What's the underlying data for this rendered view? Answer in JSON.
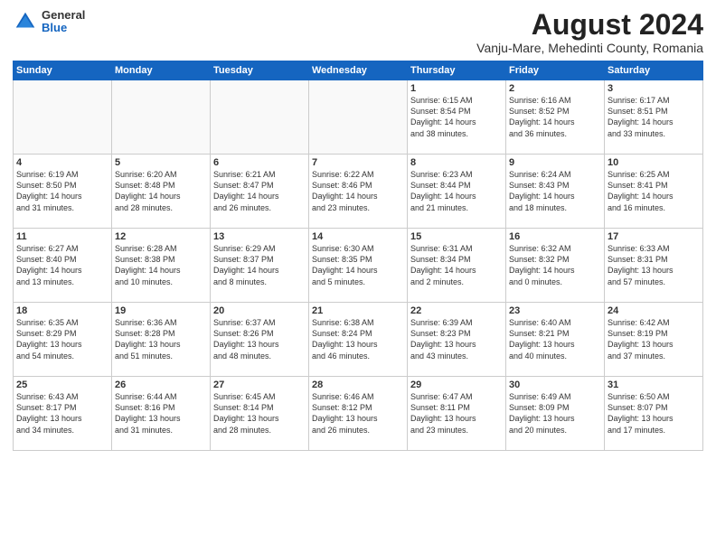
{
  "header": {
    "title": "August 2024",
    "subtitle": "Vanju-Mare, Mehedinti County, Romania",
    "logo_general": "General",
    "logo_blue": "Blue"
  },
  "weekdays": [
    "Sunday",
    "Monday",
    "Tuesday",
    "Wednesday",
    "Thursday",
    "Friday",
    "Saturday"
  ],
  "weeks": [
    [
      {
        "day": "",
        "text": ""
      },
      {
        "day": "",
        "text": ""
      },
      {
        "day": "",
        "text": ""
      },
      {
        "day": "",
        "text": ""
      },
      {
        "day": "1",
        "text": "Sunrise: 6:15 AM\nSunset: 8:54 PM\nDaylight: 14 hours\nand 38 minutes."
      },
      {
        "day": "2",
        "text": "Sunrise: 6:16 AM\nSunset: 8:52 PM\nDaylight: 14 hours\nand 36 minutes."
      },
      {
        "day": "3",
        "text": "Sunrise: 6:17 AM\nSunset: 8:51 PM\nDaylight: 14 hours\nand 33 minutes."
      }
    ],
    [
      {
        "day": "4",
        "text": "Sunrise: 6:19 AM\nSunset: 8:50 PM\nDaylight: 14 hours\nand 31 minutes."
      },
      {
        "day": "5",
        "text": "Sunrise: 6:20 AM\nSunset: 8:48 PM\nDaylight: 14 hours\nand 28 minutes."
      },
      {
        "day": "6",
        "text": "Sunrise: 6:21 AM\nSunset: 8:47 PM\nDaylight: 14 hours\nand 26 minutes."
      },
      {
        "day": "7",
        "text": "Sunrise: 6:22 AM\nSunset: 8:46 PM\nDaylight: 14 hours\nand 23 minutes."
      },
      {
        "day": "8",
        "text": "Sunrise: 6:23 AM\nSunset: 8:44 PM\nDaylight: 14 hours\nand 21 minutes."
      },
      {
        "day": "9",
        "text": "Sunrise: 6:24 AM\nSunset: 8:43 PM\nDaylight: 14 hours\nand 18 minutes."
      },
      {
        "day": "10",
        "text": "Sunrise: 6:25 AM\nSunset: 8:41 PM\nDaylight: 14 hours\nand 16 minutes."
      }
    ],
    [
      {
        "day": "11",
        "text": "Sunrise: 6:27 AM\nSunset: 8:40 PM\nDaylight: 14 hours\nand 13 minutes."
      },
      {
        "day": "12",
        "text": "Sunrise: 6:28 AM\nSunset: 8:38 PM\nDaylight: 14 hours\nand 10 minutes."
      },
      {
        "day": "13",
        "text": "Sunrise: 6:29 AM\nSunset: 8:37 PM\nDaylight: 14 hours\nand 8 minutes."
      },
      {
        "day": "14",
        "text": "Sunrise: 6:30 AM\nSunset: 8:35 PM\nDaylight: 14 hours\nand 5 minutes."
      },
      {
        "day": "15",
        "text": "Sunrise: 6:31 AM\nSunset: 8:34 PM\nDaylight: 14 hours\nand 2 minutes."
      },
      {
        "day": "16",
        "text": "Sunrise: 6:32 AM\nSunset: 8:32 PM\nDaylight: 14 hours\nand 0 minutes."
      },
      {
        "day": "17",
        "text": "Sunrise: 6:33 AM\nSunset: 8:31 PM\nDaylight: 13 hours\nand 57 minutes."
      }
    ],
    [
      {
        "day": "18",
        "text": "Sunrise: 6:35 AM\nSunset: 8:29 PM\nDaylight: 13 hours\nand 54 minutes."
      },
      {
        "day": "19",
        "text": "Sunrise: 6:36 AM\nSunset: 8:28 PM\nDaylight: 13 hours\nand 51 minutes."
      },
      {
        "day": "20",
        "text": "Sunrise: 6:37 AM\nSunset: 8:26 PM\nDaylight: 13 hours\nand 48 minutes."
      },
      {
        "day": "21",
        "text": "Sunrise: 6:38 AM\nSunset: 8:24 PM\nDaylight: 13 hours\nand 46 minutes."
      },
      {
        "day": "22",
        "text": "Sunrise: 6:39 AM\nSunset: 8:23 PM\nDaylight: 13 hours\nand 43 minutes."
      },
      {
        "day": "23",
        "text": "Sunrise: 6:40 AM\nSunset: 8:21 PM\nDaylight: 13 hours\nand 40 minutes."
      },
      {
        "day": "24",
        "text": "Sunrise: 6:42 AM\nSunset: 8:19 PM\nDaylight: 13 hours\nand 37 minutes."
      }
    ],
    [
      {
        "day": "25",
        "text": "Sunrise: 6:43 AM\nSunset: 8:17 PM\nDaylight: 13 hours\nand 34 minutes."
      },
      {
        "day": "26",
        "text": "Sunrise: 6:44 AM\nSunset: 8:16 PM\nDaylight: 13 hours\nand 31 minutes."
      },
      {
        "day": "27",
        "text": "Sunrise: 6:45 AM\nSunset: 8:14 PM\nDaylight: 13 hours\nand 28 minutes."
      },
      {
        "day": "28",
        "text": "Sunrise: 6:46 AM\nSunset: 8:12 PM\nDaylight: 13 hours\nand 26 minutes."
      },
      {
        "day": "29",
        "text": "Sunrise: 6:47 AM\nSunset: 8:11 PM\nDaylight: 13 hours\nand 23 minutes."
      },
      {
        "day": "30",
        "text": "Sunrise: 6:49 AM\nSunset: 8:09 PM\nDaylight: 13 hours\nand 20 minutes."
      },
      {
        "day": "31",
        "text": "Sunrise: 6:50 AM\nSunset: 8:07 PM\nDaylight: 13 hours\nand 17 minutes."
      }
    ]
  ]
}
